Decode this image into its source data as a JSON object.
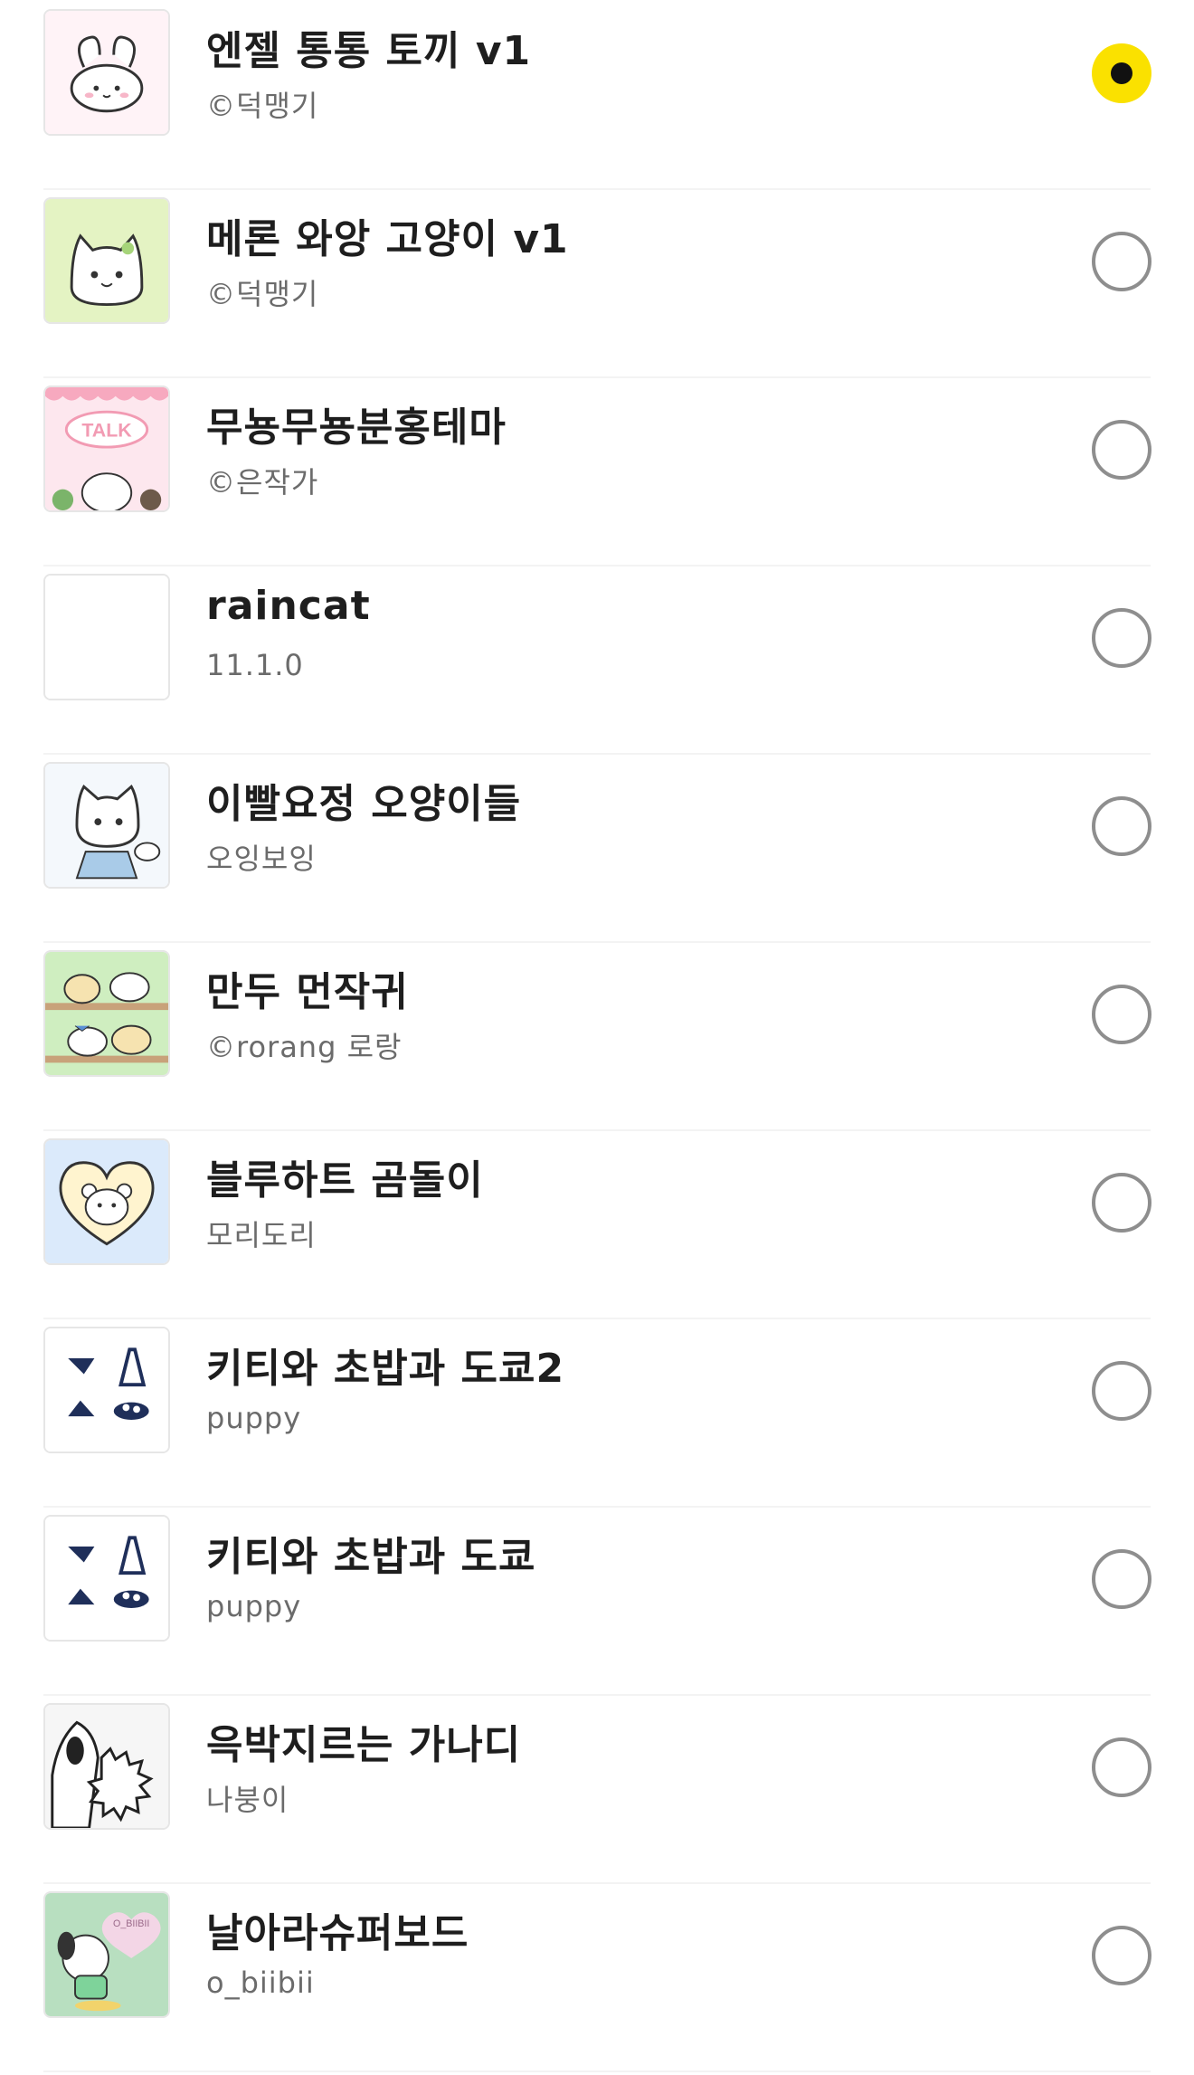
{
  "themes": [
    {
      "name": "엔젤 통통 토끼 v1",
      "author": "©덕맹기",
      "selected": true,
      "thumb_bg": "#fff3f7",
      "icon": "angel-bunny-icon"
    },
    {
      "name": "메론 와앙 고양이 v1",
      "author": "©덕맹기",
      "selected": false,
      "thumb_bg": "#e4f3c3",
      "icon": "melon-cat-icon"
    },
    {
      "name": "무뇽무뇽분홍테마",
      "author": "©은작가",
      "selected": false,
      "thumb_bg": "#fde7ee",
      "icon": "pink-talk-bunny-icon",
      "thumb_text": "TALK"
    },
    {
      "name": "raincat",
      "author": "11.1.0",
      "selected": false,
      "thumb_bg": "#ffffff",
      "icon": "blank-thumbnail-icon"
    },
    {
      "name": "이빨요정 오양이들",
      "author": "오잉보잉",
      "selected": false,
      "thumb_bg": "#f4f8fc",
      "icon": "tooth-fairy-cat-icon"
    },
    {
      "name": "만두 먼작귀",
      "author": "©rorang 로랑",
      "selected": false,
      "thumb_bg": "#cfeec0",
      "icon": "dumpling-characters-icon"
    },
    {
      "name": "블루하트 곰돌이",
      "author": "모리도리",
      "selected": false,
      "thumb_bg": "#dbeafb",
      "icon": "heart-bear-icon"
    },
    {
      "name": "키티와 초밥과 도쿄2",
      "author": "puppy",
      "selected": false,
      "thumb_bg": "#ffffff",
      "icon": "kitty-sushi-tokyo-icon"
    },
    {
      "name": "키티와 초밥과 도쿄",
      "author": "puppy",
      "selected": false,
      "thumb_bg": "#ffffff",
      "icon": "kitty-sushi-tokyo-icon"
    },
    {
      "name": "윽박지르는 가나디",
      "author": "나붕이",
      "selected": false,
      "thumb_bg": "#f6f6f6",
      "icon": "shouting-dog-icon"
    },
    {
      "name": "날아라슈퍼보드",
      "author": "o_biibii",
      "selected": false,
      "thumb_bg": "#b8dfc0",
      "icon": "flying-dog-icon",
      "thumb_text": "O_BIIBII"
    }
  ]
}
